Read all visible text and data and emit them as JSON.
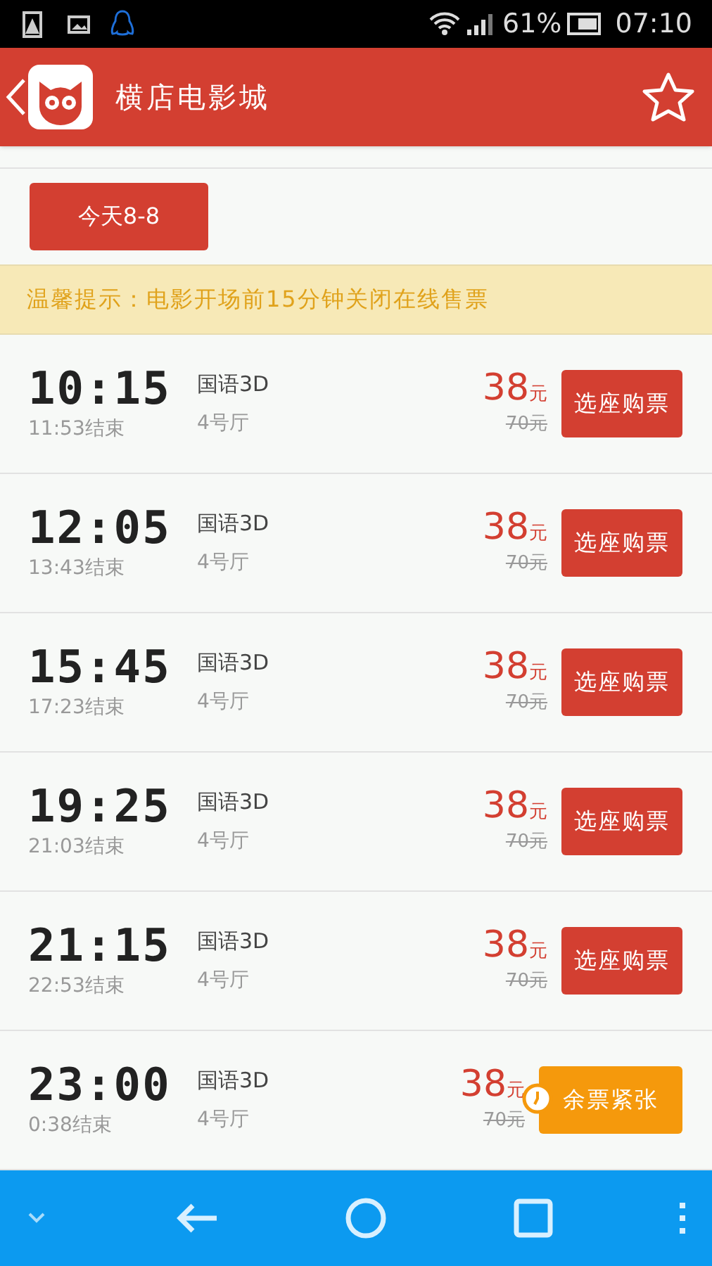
{
  "status_bar": {
    "battery": "61%",
    "time": "07:10"
  },
  "header": {
    "title": "横店电影城"
  },
  "date_tab": {
    "label": "今天8-8",
    "selected": true
  },
  "notice": "温馨提示：电影开场前15分钟关闭在线售票",
  "showtimes": [
    {
      "start": "10:15",
      "end": "11:53结束",
      "format": "国语3D",
      "hall": "4号厅",
      "price": "38",
      "unit": "元",
      "original_price": "70元",
      "button": "选座购票",
      "kind": "buy"
    },
    {
      "start": "12:05",
      "end": "13:43结束",
      "format": "国语3D",
      "hall": "4号厅",
      "price": "38",
      "unit": "元",
      "original_price": "70元",
      "button": "选座购票",
      "kind": "buy"
    },
    {
      "start": "15:45",
      "end": "17:23结束",
      "format": "国语3D",
      "hall": "4号厅",
      "price": "38",
      "unit": "元",
      "original_price": "70元",
      "button": "选座购票",
      "kind": "buy"
    },
    {
      "start": "19:25",
      "end": "21:03结束",
      "format": "国语3D",
      "hall": "4号厅",
      "price": "38",
      "unit": "元",
      "original_price": "70元",
      "button": "选座购票",
      "kind": "buy"
    },
    {
      "start": "21:15",
      "end": "22:53结束",
      "format": "国语3D",
      "hall": "4号厅",
      "price": "38",
      "unit": "元",
      "original_price": "70元",
      "button": "选座购票",
      "kind": "buy"
    },
    {
      "start": "23:00",
      "end": "0:38结束",
      "format": "国语3D",
      "hall": "4号厅",
      "price": "38",
      "unit": "元",
      "original_price": "70元",
      "button": "余票紧张",
      "kind": "scarce"
    }
  ]
}
